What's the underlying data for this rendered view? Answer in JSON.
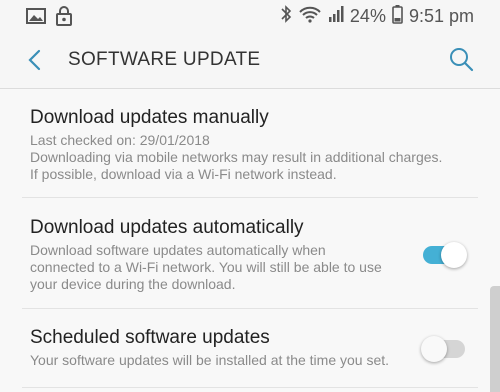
{
  "status_bar": {
    "battery_percent": "24%",
    "time": "9:51 pm",
    "left_icons": [
      "image-icon",
      "lock-icon"
    ],
    "right_icons": [
      "bluetooth-icon",
      "wifi-icon",
      "signal-icon",
      "battery-icon"
    ]
  },
  "header": {
    "title": "SOFTWARE UPDATE",
    "back_icon": "back-arrow-icon",
    "search_icon": "search-icon",
    "accent_color": "#3a8fb7"
  },
  "settings": [
    {
      "title": "Download updates manually",
      "lines": [
        "Last checked on: 29/01/2018",
        "Downloading via mobile networks may result in additional charges.",
        "If possible, download via a Wi-Fi network instead."
      ],
      "toggle": null
    },
    {
      "title": "Download updates automatically",
      "lines": [
        "Download software updates automatically when",
        "connected to a Wi-Fi network. You will still be able to use",
        "your device during the download."
      ],
      "toggle": "on"
    },
    {
      "title": "Scheduled software updates",
      "lines": [
        "Your software updates will be installed at the time you set."
      ],
      "toggle": "off"
    }
  ],
  "colors": {
    "toggle_on": "#44b0d5",
    "toggle_off": "#d5d5d5"
  }
}
